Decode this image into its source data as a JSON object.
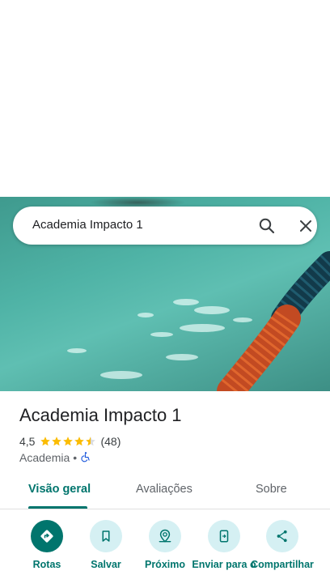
{
  "search": {
    "query": "Academia Impacto 1"
  },
  "place": {
    "title": "Academia Impacto 1",
    "rating": "4,5",
    "rating_value": 4.5,
    "review_count": "(48)",
    "category": "Academia",
    "separator": "•",
    "icons": {
      "accessibility": "wheelchair-icon"
    }
  },
  "tabs": [
    {
      "label": "Visão geral",
      "active": true
    },
    {
      "label": "Avaliações",
      "active": false
    },
    {
      "label": "Sobre",
      "active": false
    }
  ],
  "actions": [
    {
      "label": "Rotas",
      "icon": "directions-icon"
    },
    {
      "label": "Salvar",
      "icon": "bookmark-icon"
    },
    {
      "label": "Próximo",
      "icon": "nearby-icon"
    },
    {
      "label": "Enviar para o",
      "icon": "send-to-phone-icon"
    },
    {
      "label": "Compartilhar",
      "icon": "share-icon"
    }
  ],
  "colors": {
    "accent": "#00756d",
    "action_bg": "#d5f0f3",
    "star": "#fbbc04",
    "text_primary": "#202124",
    "text_secondary": "#5f6368"
  }
}
